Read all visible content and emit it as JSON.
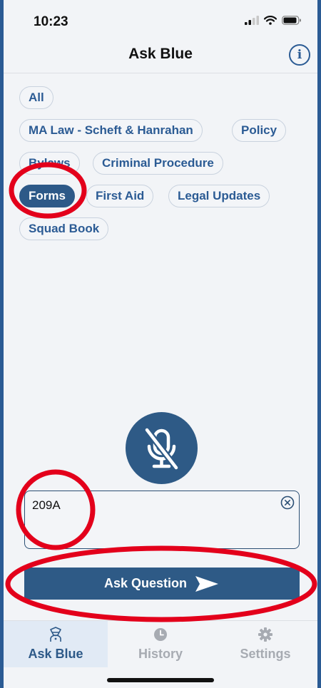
{
  "status_bar": {
    "time": "10:23"
  },
  "header": {
    "title": "Ask Blue",
    "info_icon": "info-icon",
    "info_glyph": "i"
  },
  "categories": {
    "chips": [
      {
        "label": "All",
        "selected": false
      },
      {
        "label": "MA Law - Scheft & Hanrahan",
        "selected": false
      },
      {
        "label": "Policy",
        "selected": false
      },
      {
        "label": "Bylaws",
        "selected": false
      },
      {
        "label": "Criminal Procedure",
        "selected": false
      },
      {
        "label": "Forms",
        "selected": true
      },
      {
        "label": "First Aid",
        "selected": false
      },
      {
        "label": "Legal Updates",
        "selected": false
      },
      {
        "label": "Squad Book",
        "selected": false
      }
    ]
  },
  "voice": {
    "icon": "microphone-off-icon"
  },
  "question_input": {
    "value": "209A",
    "clear_icon": "clear-circle-icon"
  },
  "ask_button": {
    "label": "Ask Question",
    "icon": "send-arrow-icon"
  },
  "tabbar": {
    "tabs": [
      {
        "label": "Ask Blue",
        "icon": "police-officer-icon",
        "active": true
      },
      {
        "label": "History",
        "icon": "clock-icon",
        "active": false
      },
      {
        "label": "Settings",
        "icon": "gear-icon",
        "active": false
      }
    ]
  },
  "colors": {
    "brand": "#2d5988",
    "frame_border": "#2b5b94",
    "background": "#f2f4f7",
    "annotation": "#e3001b",
    "inactive_tab": "#a7abb2"
  }
}
